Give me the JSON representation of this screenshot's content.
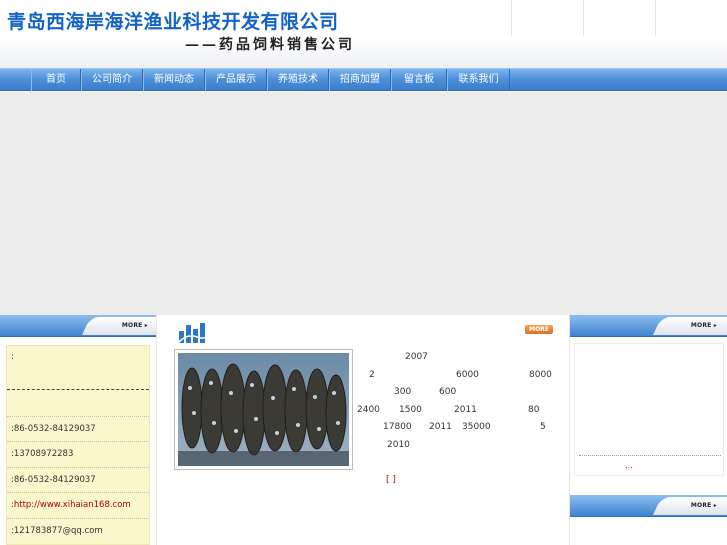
{
  "header": {
    "title": "青岛西海岸海洋渔业科技开发有限公司",
    "subtitle": "——药品饲料销售公司"
  },
  "nav": {
    "items": [
      {
        "label": "首页"
      },
      {
        "label": "公司简介"
      },
      {
        "label": "新闻动态"
      },
      {
        "label": "产品展示"
      },
      {
        "label": "养殖技术"
      },
      {
        "label": "招商加盟"
      },
      {
        "label": "留言板"
      },
      {
        "label": "联系我们"
      }
    ]
  },
  "left": {
    "more_label": "MORE",
    "contact": {
      "line1": ":",
      "phone": ":86-0532-84129037",
      "mobile": ":13708972283",
      "fax": ":86-0532-84129037",
      "website": ":http://www.xihaian168.com",
      "qq": ":121783877@qq.com"
    }
  },
  "center": {
    "more_label": "MORE",
    "intro_fragments": [
      "2007",
      "2",
      "6000",
      "8000",
      "300",
      "600",
      "2400",
      "1500",
      "2011",
      "80",
      "17800",
      "2011",
      "35000",
      "5",
      "2010"
    ],
    "detail_link": "[ ]"
  },
  "right": {
    "more_label": "MORE",
    "more_label_2": "MORE",
    "dots": "..."
  },
  "colors": {
    "title_blue": "#1463c7",
    "nav_blue": "#4c8fd8",
    "contact_bg": "#fbf6cc",
    "more_orange": "#d9701e",
    "link_red": "#cc0000"
  }
}
